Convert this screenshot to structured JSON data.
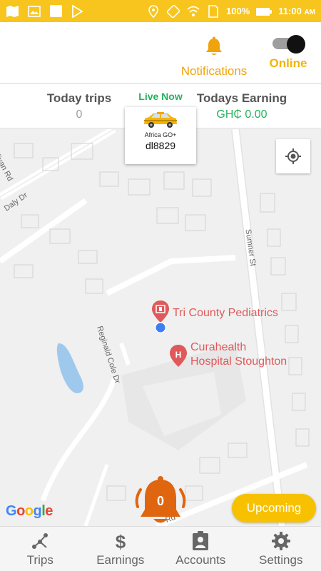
{
  "status_bar": {
    "battery": "100%",
    "time": "11:00",
    "ampm": "AM",
    "icons": [
      "map-icon",
      "image-icon",
      "square-icon",
      "play-store-icon",
      "location-icon",
      "rotate-icon",
      "wifi-icon",
      "sim-icon",
      "battery-icon"
    ]
  },
  "header": {
    "notifications_label": "Notifications",
    "online_label": "Online",
    "online_toggle_on": true
  },
  "stats": {
    "today_trips_label": "Today trips",
    "today_trips_value": "0",
    "live_now_label": "Live Now",
    "todays_earning_label": "Todays Earning",
    "todays_earning_value": "GH₵ 0.00"
  },
  "vehicle": {
    "brand": "Africa GO+",
    "id": "dl8829"
  },
  "map": {
    "poi_1": "Tri County Pediatrics",
    "poi_2_line1": "Curahealth",
    "poi_2_line2": "Hospital Stoughton",
    "streets": {
      "sullivan": "Sullivan Rd",
      "daly": "Daly Dr",
      "sumner": "Sumner St",
      "reginald": "Reginald Cole Dr",
      "rd_fragment": "Rd"
    },
    "google_logo": "Google"
  },
  "alarm": {
    "count": "0"
  },
  "upcoming_label": "Upcoming",
  "nav": {
    "trips": "Trips",
    "earnings": "Earnings",
    "accounts": "Accounts",
    "settings": "Settings"
  },
  "colors": {
    "status_bar": "#f7c51e",
    "accent_orange": "#f0a30a",
    "online_yellow": "#f4b400",
    "green": "#21b35b",
    "alarm_orange": "#e0650f",
    "poi_red": "#e0595a"
  }
}
